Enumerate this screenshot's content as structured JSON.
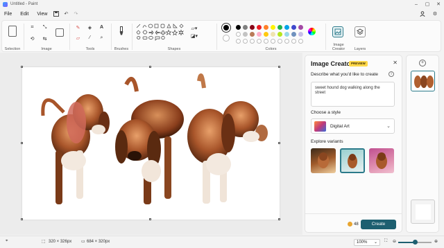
{
  "window": {
    "title": "Untitled - Paint"
  },
  "menu": {
    "items": [
      "File",
      "Edit",
      "View"
    ]
  },
  "ribbon": {
    "groups": [
      "Selection",
      "Image",
      "Tools",
      "Brushes",
      "Shapes",
      "Colors",
      "Image Creator",
      "Layers"
    ]
  },
  "colors": {
    "primary": "#000000",
    "secondary": "#ffffff",
    "palette_row1": [
      "#000000",
      "#7f7f7f",
      "#880015",
      "#ed1c24",
      "#ff7f27",
      "#fff200",
      "#22b14c",
      "#00a2e8",
      "#3f48cc",
      "#a349a4"
    ],
    "palette_row2": [
      "#ffffff",
      "#c3c3c3",
      "#b97a57",
      "#ffaec9",
      "#ffc90e",
      "#efe4b0",
      "#b5e61d",
      "#99d9ea",
      "#7092be",
      "#c8bfe7"
    ],
    "accent": "#1d5f70"
  },
  "panel": {
    "title": "Image Creator",
    "badge": "PREVIEW",
    "describe_label": "Describe what you'd like to create",
    "prompt_value": "sweet hound dog walking along the street",
    "style_label": "Choose a style",
    "style_value": "Digital Art",
    "variants_label": "Explore variants",
    "credits": "48",
    "create_label": "Create"
  },
  "status": {
    "selection_size": "320 × 326px",
    "canvas_size": "684 × 320px",
    "zoom": "100%",
    "zoom_fraction": 0.5
  }
}
